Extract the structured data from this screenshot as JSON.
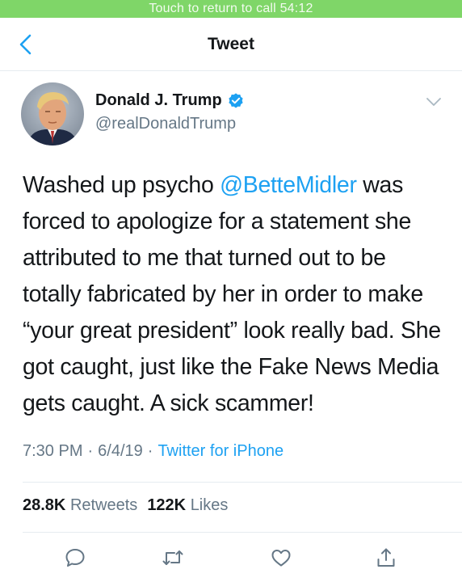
{
  "status_bar": {
    "call_text": "Touch to return to call 54:12"
  },
  "nav": {
    "title": "Tweet"
  },
  "author": {
    "name": "Donald J. Trump",
    "handle": "@realDonaldTrump"
  },
  "tweet": {
    "before_mention": "Washed up psycho ",
    "mention": "@BetteMidler",
    "after_mention": " was forced to apologize for a statement she attributed to me that turned out to be totally fabricated by her in order to make “your great president” look really bad. She got caught, just like the Fake News Media gets caught. A sick scammer!"
  },
  "meta": {
    "time": "7:30 PM",
    "date": "6/4/19",
    "source": "Twitter for iPhone",
    "separator": "·"
  },
  "stats": {
    "retweets_count": "28.8K",
    "retweets_label": "Retweets",
    "likes_count": "122K",
    "likes_label": "Likes"
  },
  "icons": [
    "back-chevron-icon",
    "verified-badge-icon",
    "chevron-down-icon",
    "reply-icon",
    "retweet-icon",
    "like-icon",
    "share-icon"
  ],
  "colors": {
    "call_bar": "#7fd668",
    "accent": "#1da1f2",
    "secondary_text": "#657786",
    "divider": "#e6ecf0"
  }
}
